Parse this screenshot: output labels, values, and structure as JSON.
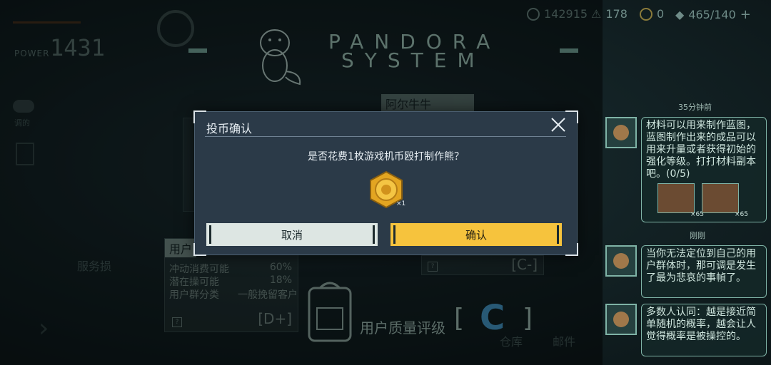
{
  "top": {
    "power_label": "POWER",
    "power_value": "1431",
    "gold": "142915",
    "warning": "178",
    "gems": "0",
    "stamina": "465/140",
    "plus": "+"
  },
  "title": {
    "line1": "PANDORA",
    "line2": "SYSTEM"
  },
  "left_nav": {
    "item1": "调的",
    "item2": "服务损"
  },
  "name_tag": "阿尔牛牛",
  "user_panel": {
    "tag": "用户",
    "rows": [
      {
        "label": "冲动消费可能",
        "value": "60%"
      },
      {
        "label": "潜在操可能",
        "value": "18%"
      },
      {
        "label": "用户群分类",
        "value": "一般挽留客户"
      }
    ],
    "grade": "[D+]"
  },
  "mid_panel": {
    "grade": "[C-]"
  },
  "quality": {
    "label": "用户质量评级",
    "grade": "C"
  },
  "bottom_labels": {
    "warehouse": "仓库",
    "mail": "邮件"
  },
  "modal": {
    "title": "投币确认",
    "question": "是否花费1枚游戏机币殴打制作熊？",
    "coin_count": "×1",
    "cancel": "取消",
    "confirm": "确认"
  },
  "chat": [
    {
      "time": "35分钟前",
      "text": "材料可以用来制作蓝图，蓝图制作出来的成品可以用来升量或者获得初始的强化等级。打打材料副本吧。(0/5)",
      "items": [
        "×65",
        "×65"
      ]
    },
    {
      "time": "刚刚",
      "text": "当你无法定位到自己的用户群体时，那可调是发生了最为悲哀的事幀了。"
    },
    {
      "time": "",
      "text": "多数人认同：越是接近简单随机的概率，越会让人觉得概率是被操控的。"
    }
  ],
  "colors": {
    "accent": "#f6c33d",
    "panel": "#2b3a48",
    "teal": "#7fb3a6"
  }
}
